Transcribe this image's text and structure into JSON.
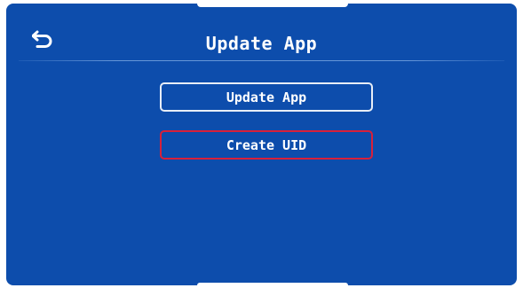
{
  "header": {
    "title": "Update App",
    "back_icon": "back-arrow-icon"
  },
  "menu": {
    "items": [
      {
        "label": "Update App",
        "selected": false
      },
      {
        "label": "Create UID",
        "selected": true
      }
    ]
  },
  "colors": {
    "background": "#0d4dac",
    "text": "#ffffff",
    "button_border": "#e8eef7",
    "selected_border": "#d8203a"
  }
}
